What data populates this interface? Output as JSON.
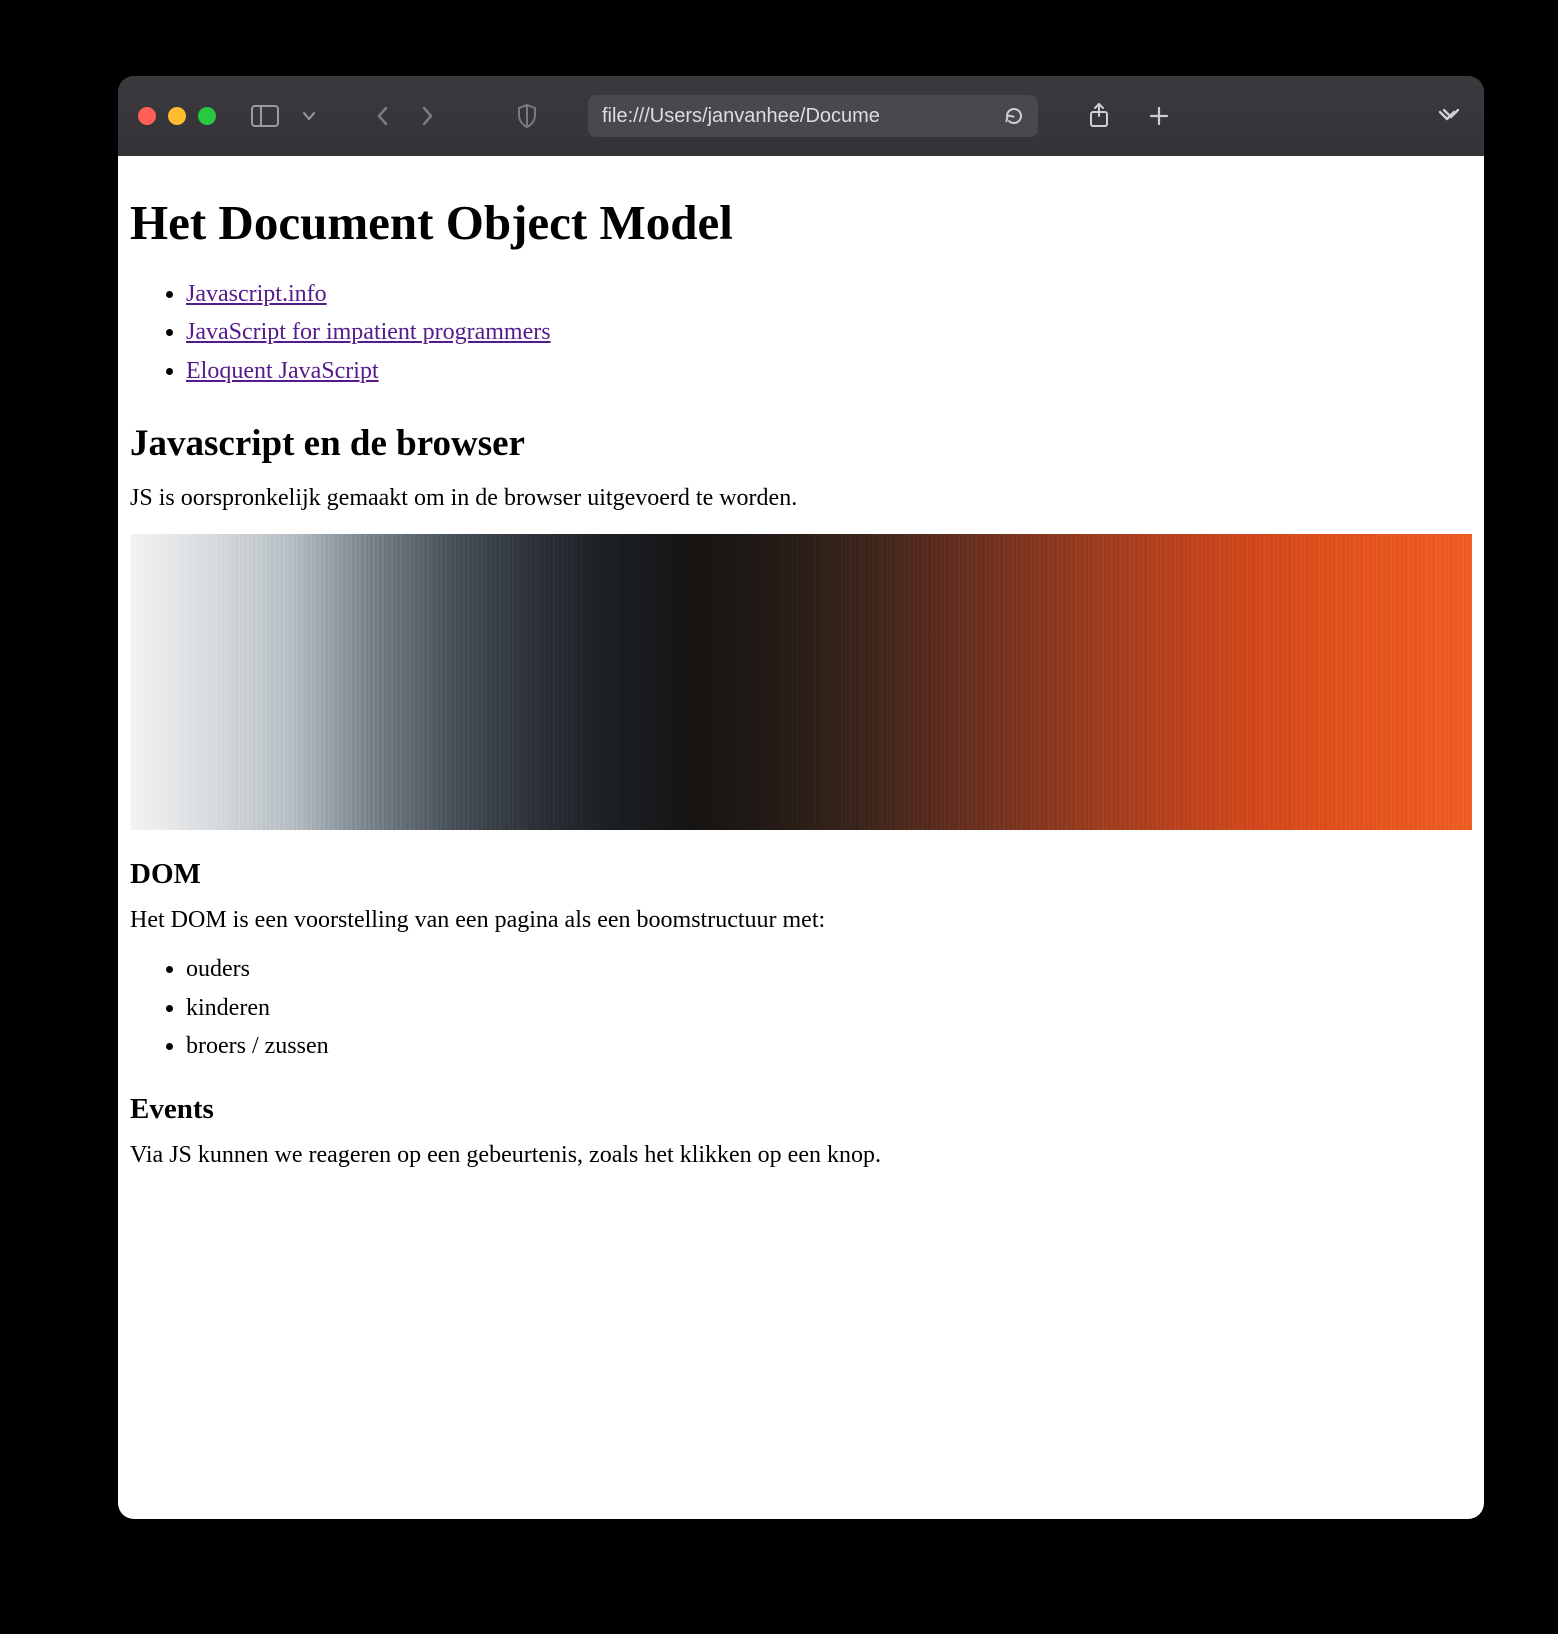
{
  "browser": {
    "url_display": "file:///Users/janvanhee/Docume"
  },
  "page": {
    "title": "Het Document Object Model",
    "links": [
      {
        "label": "Javascript.info"
      },
      {
        "label": "JavaScript for impatient programmers"
      },
      {
        "label": "Eloquent JavaScript"
      }
    ],
    "section_js_browser": {
      "heading": "Javascript en de browser",
      "paragraph": "JS is oorspronkelijk gemaakt om in de browser uitgevoerd te worden."
    },
    "section_dom": {
      "heading": "DOM",
      "paragraph": "Het DOM is een voorstelling van een pagina als een boomstructuur met:",
      "items": [
        "ouders",
        "kinderen",
        "broers / zussen"
      ]
    },
    "section_events": {
      "heading": "Events",
      "paragraph": "Via JS kunnen we reageren op een gebeurtenis, zoals het klikken op een knop."
    }
  }
}
